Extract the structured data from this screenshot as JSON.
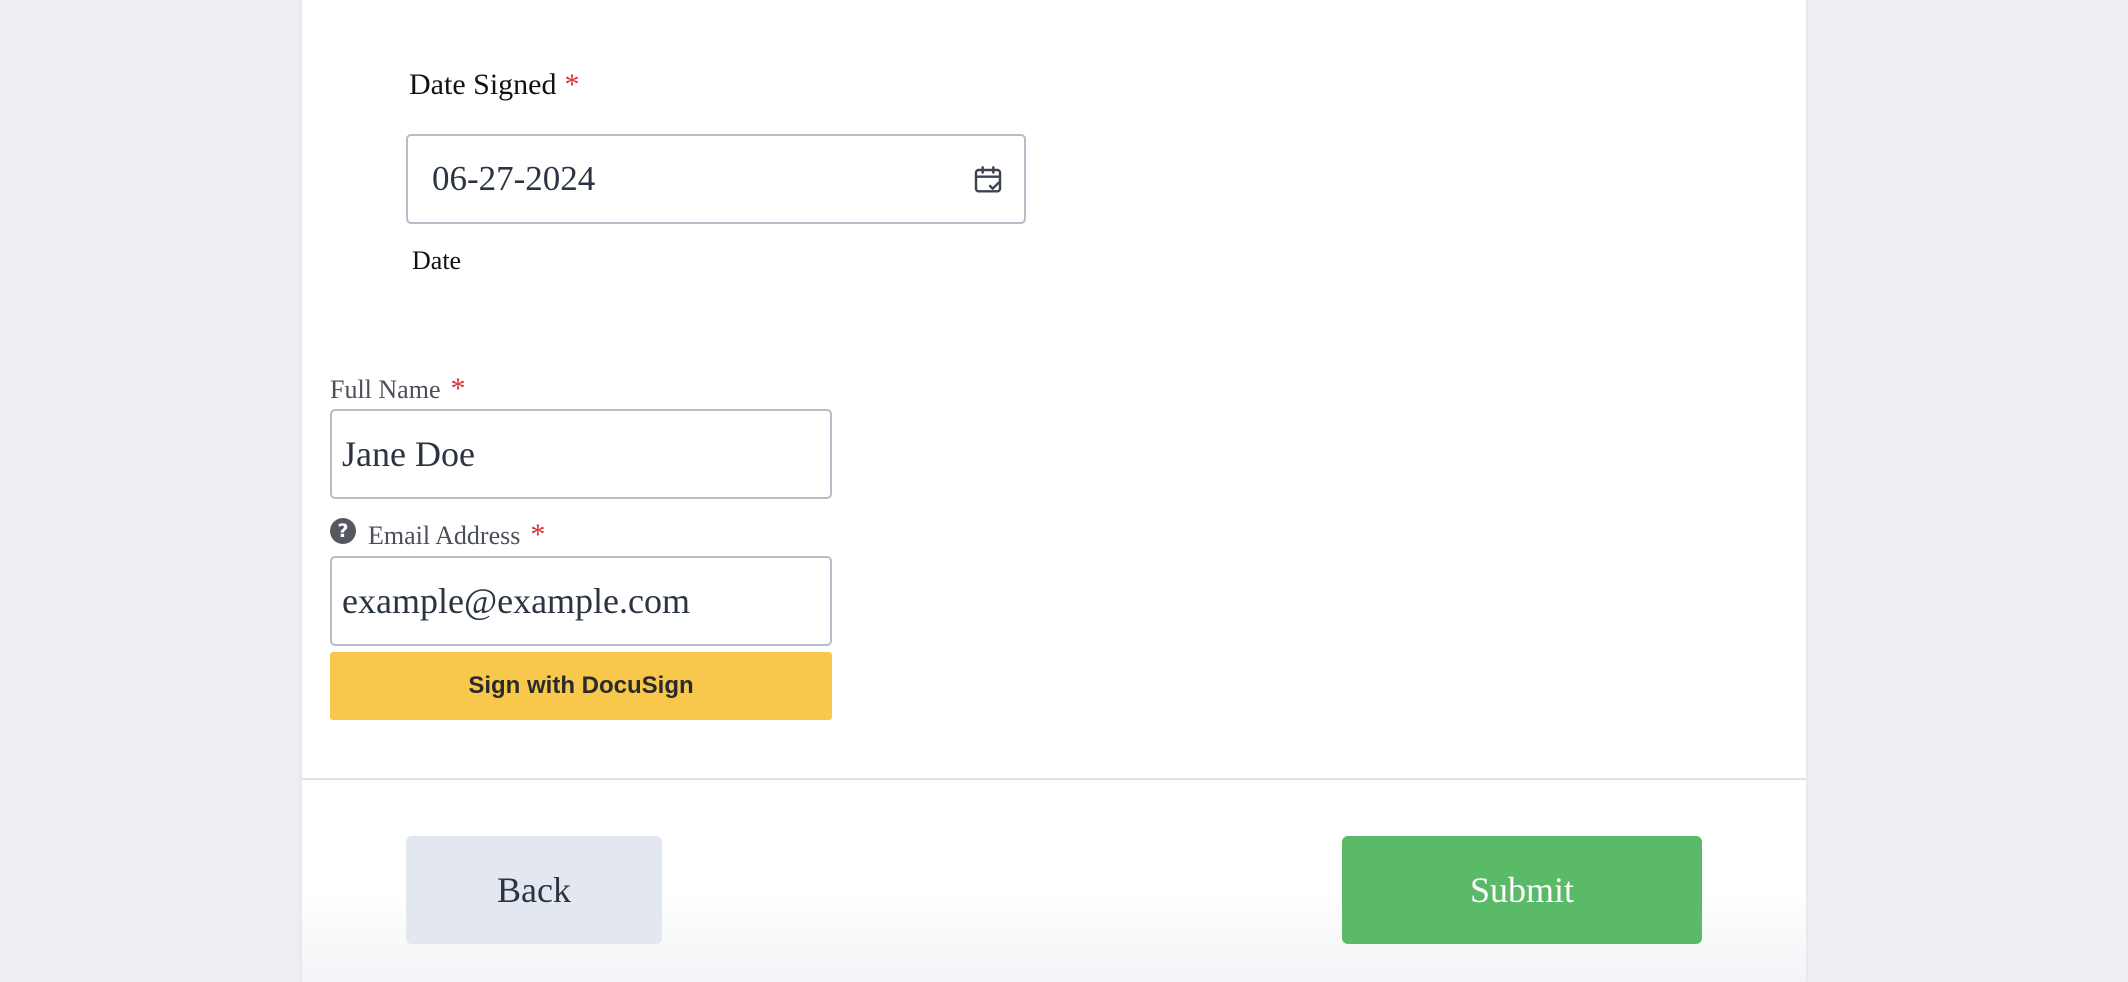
{
  "date_field": {
    "label": "Date Signed",
    "required_mark": "*",
    "value": "06-27-2024",
    "sublabel": "Date",
    "icon": "calendar-check-icon"
  },
  "full_name": {
    "label": "Full Name",
    "required_mark": "*",
    "value": "Jane Doe"
  },
  "email": {
    "label": "Email Address",
    "required_mark": "*",
    "value": "example@example.com",
    "help_icon": "question-circle-icon",
    "help_glyph": "?"
  },
  "docusign_button": {
    "label": "Sign with DocuSign"
  },
  "footer": {
    "back_label": "Back",
    "submit_label": "Submit"
  },
  "colors": {
    "required": "#d63131",
    "docusign": "#f7c84c",
    "submit": "#5aba68",
    "back": "#e3e7f0"
  }
}
